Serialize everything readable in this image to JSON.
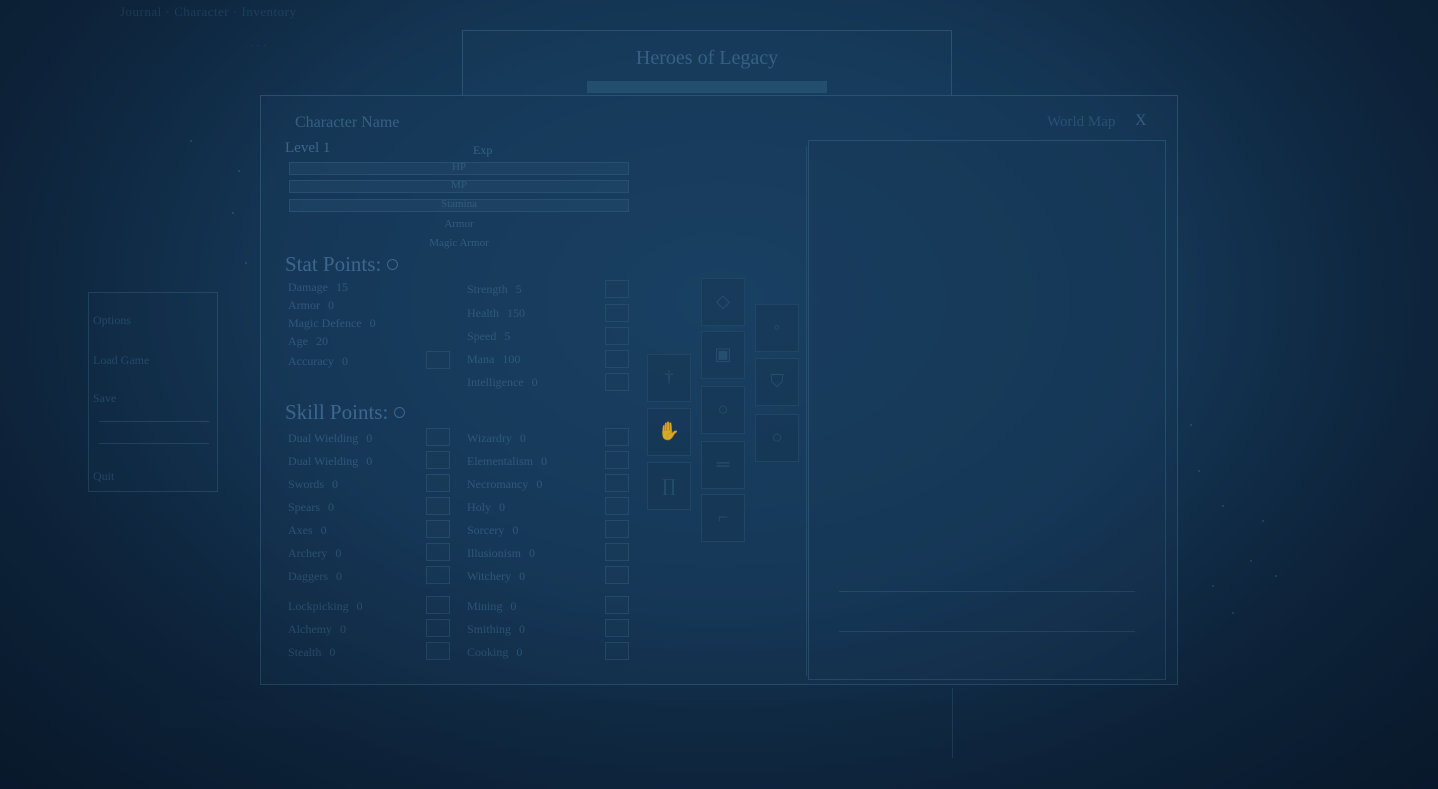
{
  "header": {
    "top_text": "Journal · Character · Inventory",
    "sub_text": "· · ·",
    "title": "Heroes of Legacy"
  },
  "side_menu": {
    "items": [
      "Options",
      "Load Game",
      "Save",
      "Quit"
    ]
  },
  "character": {
    "name": "Character Name",
    "level_label": "Level 1",
    "exp_label": "Exp",
    "bars": [
      {
        "label": "HP"
      },
      {
        "label": "MP"
      },
      {
        "label": "Stamina"
      }
    ],
    "armor_label": "Armor",
    "magic_armor_label": "Magic Armor"
  },
  "world_map": {
    "label": "World Map",
    "close": "X"
  },
  "stat_points": {
    "label": "Stat Points:",
    "left": [
      {
        "name": "Damage",
        "value": "15"
      },
      {
        "name": "Armor",
        "value": "0"
      },
      {
        "name": "Magic Defence",
        "value": "0"
      },
      {
        "name": "Age",
        "value": "20"
      },
      {
        "name": "Accuracy",
        "value": "0"
      }
    ],
    "right": [
      {
        "name": "Strength",
        "value": "5"
      },
      {
        "name": "Health",
        "value": "150"
      },
      {
        "name": "Speed",
        "value": "5"
      },
      {
        "name": "Mana",
        "value": "100"
      },
      {
        "name": "Intelligence",
        "value": "0"
      }
    ]
  },
  "skill_points": {
    "label": "Skill Points:",
    "left": [
      {
        "name": "Dual Wielding",
        "value": "0"
      },
      {
        "name": "Dual Wielding",
        "value": "0"
      },
      {
        "name": "Swords",
        "value": "0"
      },
      {
        "name": "Spears",
        "value": "0"
      },
      {
        "name": "Axes",
        "value": "0"
      },
      {
        "name": "Archery",
        "value": "0"
      },
      {
        "name": "Daggers",
        "value": "0"
      },
      {
        "name": "Lockpicking",
        "value": "0"
      },
      {
        "name": "Alchemy",
        "value": "0"
      },
      {
        "name": "Stealth",
        "value": "0"
      }
    ],
    "right": [
      {
        "name": "Wizardry",
        "value": "0"
      },
      {
        "name": "Elementalism",
        "value": "0"
      },
      {
        "name": "Necromancy",
        "value": "0"
      },
      {
        "name": "Holy",
        "value": "0"
      },
      {
        "name": "Sorcery",
        "value": "0"
      },
      {
        "name": "Illusionism",
        "value": "0"
      },
      {
        "name": "Witchery",
        "value": "0"
      },
      {
        "name": "Mining",
        "value": "0"
      },
      {
        "name": "Smithing",
        "value": "0"
      },
      {
        "name": "Cooking",
        "value": "0"
      }
    ]
  },
  "equipment_icons": [
    "helmet-icon",
    "amulet-icon",
    "sword-icon",
    "chest-icon",
    "shield-icon",
    "ring-icon",
    "gloves-icon",
    "belt-icon",
    "boots-icon",
    "ring-icon"
  ],
  "colors": {
    "background": "#173e60",
    "panel_border": "#2f5f82",
    "text": "#3d6f93"
  }
}
